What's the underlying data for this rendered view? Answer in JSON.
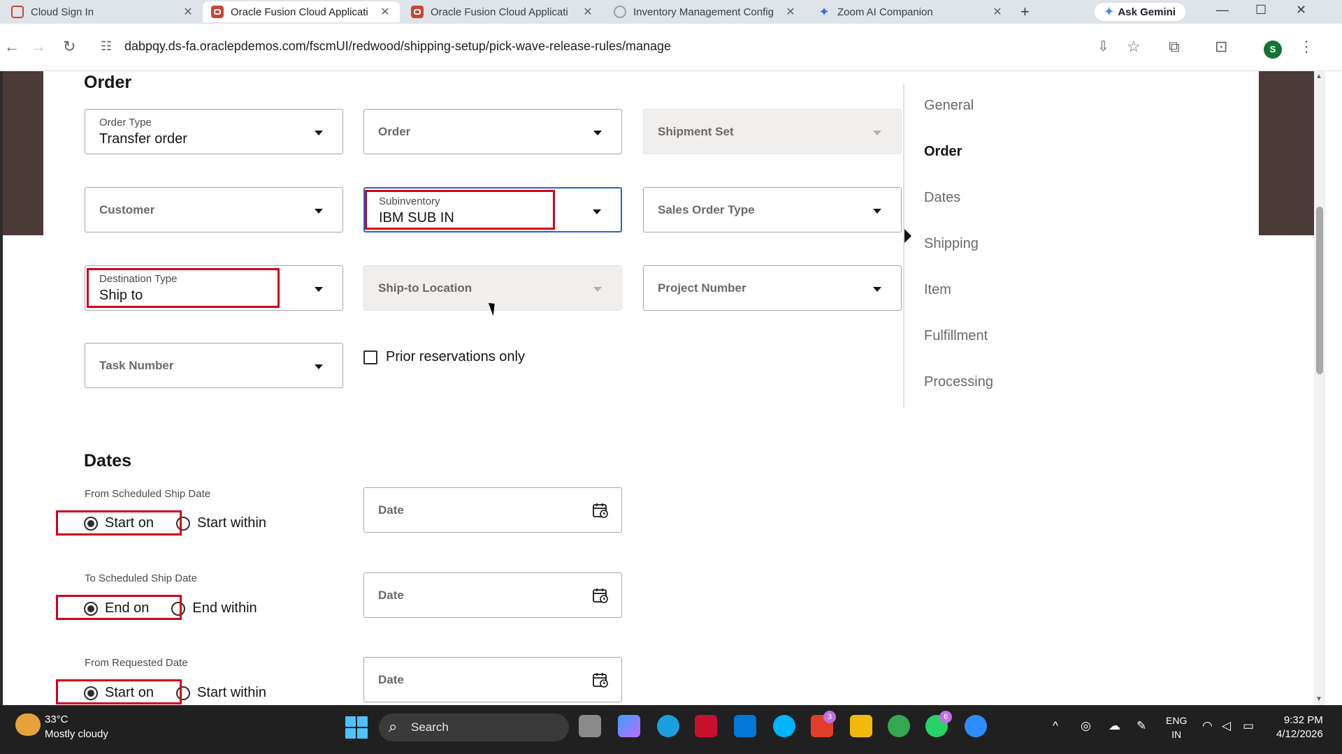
{
  "browser": {
    "tabs": [
      {
        "label": "Cloud Sign In",
        "active": false
      },
      {
        "label": "Oracle Fusion Cloud Applicati",
        "active": true
      },
      {
        "label": "Oracle Fusion Cloud Applicati",
        "active": false
      },
      {
        "label": "Inventory Management Config",
        "active": false
      },
      {
        "label": "Zoom AI Companion",
        "active": false
      }
    ],
    "ask_gemini": "Ask Gemini",
    "url": "dabpqy.ds-fa.oraclepdemos.com/fscmUI/redwood/shipping-setup/pick-wave-release-rules/manage",
    "profile_initial": "S"
  },
  "order_section": {
    "title": "Order",
    "fields": {
      "order_type": {
        "label": "Order Type",
        "value": "Transfer order"
      },
      "order": {
        "label": "Order"
      },
      "shipment_set": {
        "label": "Shipment Set"
      },
      "customer": {
        "label": "Customer"
      },
      "subinventory": {
        "label": "Subinventory",
        "value": "IBM SUB IN"
      },
      "sales_order_type": {
        "label": "Sales Order Type"
      },
      "destination_type": {
        "label": "Destination Type",
        "value": "Ship to"
      },
      "ship_to_location": {
        "label": "Ship-to Location"
      },
      "project_number": {
        "label": "Project Number"
      },
      "task_number": {
        "label": "Task Number"
      }
    },
    "prior_reservations_label": "Prior reservations only"
  },
  "dates_section": {
    "title": "Dates",
    "rows": [
      {
        "caption": "From Scheduled Ship Date",
        "opt1": "Start on",
        "opt2": "Start within",
        "date_label": "Date"
      },
      {
        "caption": "To Scheduled Ship Date",
        "opt1": "End on",
        "opt2": "End within",
        "date_label": "Date"
      },
      {
        "caption": "From Requested Date",
        "opt1": "Start on",
        "opt2": "Start within",
        "date_label": "Date"
      }
    ]
  },
  "side_nav": {
    "items": [
      "General",
      "Order",
      "Dates",
      "Shipping",
      "Item",
      "Fulfillment",
      "Processing"
    ],
    "active": "Order"
  },
  "taskbar": {
    "weather_temp": "33°C",
    "weather_desc": "Mostly cloudy",
    "search_label": "Search",
    "lang_1": "ENG",
    "lang_2": "IN",
    "time": "9:32 PM",
    "date": "4/12/2026",
    "badge_l": "3",
    "badge_wa": "6"
  }
}
